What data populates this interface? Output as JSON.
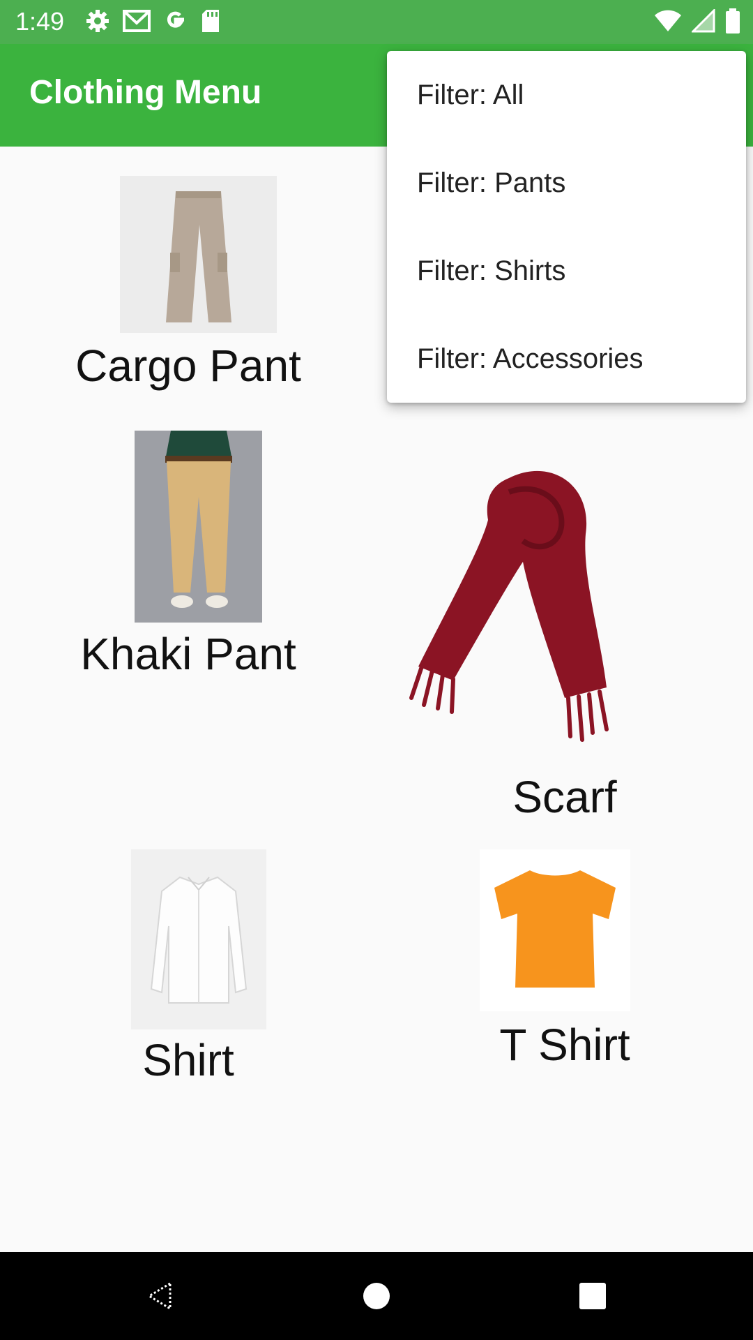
{
  "status_bar": {
    "time": "1:49",
    "left_icons": [
      "settings-icon",
      "gmail-icon",
      "google-icon",
      "sd-card-icon"
    ],
    "right_icons": [
      "wifi-icon",
      "signal-icon",
      "battery-icon"
    ]
  },
  "app_bar": {
    "title": "Clothing Menu"
  },
  "items": [
    {
      "label": "Cargo Pant",
      "icon": "cargo-pant-image"
    },
    {
      "label": "Khaki Pant",
      "icon": "khaki-pant-image"
    },
    {
      "label": "Scarf",
      "icon": "scarf-image"
    },
    {
      "label": "Shirt",
      "icon": "shirt-image"
    },
    {
      "label": "T Shirt",
      "icon": "t-shirt-image"
    }
  ],
  "menu": {
    "items": [
      "Filter: All",
      "Filter: Pants",
      "Filter: Shirts",
      "Filter: Accessories"
    ]
  },
  "nav_bar": {
    "buttons": [
      "back-icon",
      "home-icon",
      "recents-icon"
    ]
  },
  "colors": {
    "status_bar": "#4caf50",
    "app_bar": "#3bb33e",
    "background": "#fafafa",
    "scarf": "#8b1424",
    "t_shirt": "#f7941d"
  }
}
